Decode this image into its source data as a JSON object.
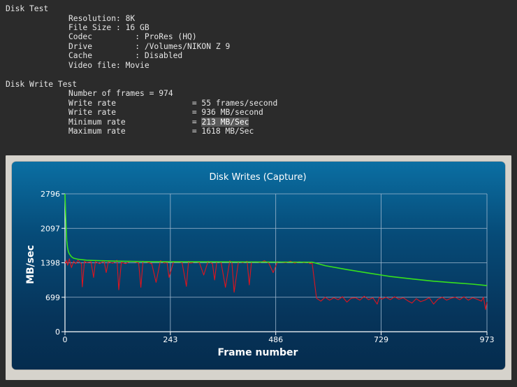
{
  "disk_test": {
    "title": "Disk Test",
    "resolution": "Resolution: 8K",
    "file_size": "File Size : 16 GB",
    "codec": "Codec         : ProRes (HQ)",
    "drive": "Drive         : /Volumes/NIKON Z 9",
    "cache": "Cache         : Disabled",
    "video_file": "Video file: Movie"
  },
  "write_test": {
    "title": "Disk Write Test",
    "frames": "Number of frames = 974",
    "write_rate_fps": "Write rate                = 55 frames/second",
    "write_rate_mbs": "Write rate                = 936 MB/second",
    "min_rate_label": "Minimum rate              = ",
    "min_rate_value": "213 MB/Sec",
    "max_rate": "Maximum rate              = 1618 MB/Sec"
  },
  "colors": {
    "per_frame_line": "#e0141e",
    "average_line": "#37e01c",
    "grid": "#9fb8cf",
    "axis_text": "#ffffff"
  },
  "chart_data": {
    "type": "line",
    "title": "Disk Writes (Capture)",
    "xlabel": "Frame number",
    "ylabel": "MB/sec",
    "xlim": [
      0,
      973
    ],
    "ylim": [
      0,
      2796
    ],
    "x_ticks": [
      0,
      243,
      486,
      729,
      973
    ],
    "y_ticks": [
      0,
      699,
      1398,
      2097,
      2796
    ],
    "grid": true,
    "legend": "none",
    "series": [
      {
        "color": "#37e01c",
        "x": [
          0,
          1,
          2,
          3,
          4,
          6,
          8,
          10,
          15,
          20,
          30,
          50,
          80,
          120,
          200,
          300,
          400,
          500,
          570,
          575,
          600,
          650,
          700,
          729,
          750,
          800,
          850,
          900,
          940,
          973
        ],
        "y": [
          2796,
          2550,
          2300,
          2050,
          1850,
          1700,
          1620,
          1580,
          1520,
          1490,
          1470,
          1450,
          1440,
          1430,
          1420,
          1418,
          1415,
          1412,
          1410,
          1400,
          1340,
          1260,
          1190,
          1150,
          1120,
          1070,
          1025,
          990,
          965,
          935
        ]
      },
      {
        "color": "#e0141e",
        "x": [
          0,
          2,
          4,
          6,
          8,
          10,
          15,
          20,
          25,
          30,
          35,
          38,
          40,
          45,
          50,
          60,
          66,
          70,
          80,
          90,
          95,
          100,
          110,
          120,
          124,
          130,
          140,
          150,
          160,
          170,
          175,
          180,
          190,
          200,
          210,
          220,
          230,
          235,
          240,
          250,
          260,
          270,
          280,
          285,
          290,
          300,
          310,
          320,
          330,
          340,
          345,
          350,
          360,
          370,
          380,
          385,
          390,
          400,
          410,
          420,
          425,
          430,
          440,
          450,
          460,
          470,
          480,
          490,
          500,
          510,
          520,
          530,
          540,
          550,
          560,
          565,
          570,
          580,
          590,
          600,
          610,
          620,
          630,
          640,
          650,
          660,
          670,
          680,
          690,
          700,
          710,
          720,
          725,
          730,
          740,
          750,
          760,
          770,
          780,
          790,
          800,
          810,
          820,
          830,
          840,
          850,
          860,
          870,
          880,
          890,
          900,
          910,
          920,
          930,
          940,
          950,
          960,
          965,
          970,
          973
        ],
        "y": [
          1420,
          1390,
          1450,
          1350,
          1400,
          1480,
          1300,
          1430,
          1380,
          1450,
          1400,
          1380,
          910,
          1430,
          1400,
          1420,
          1100,
          1420,
          1380,
          1440,
          1200,
          1420,
          1390,
          1450,
          850,
          1410,
          1380,
          1430,
          1420,
          1390,
          900,
          1430,
          1410,
          1380,
          1000,
          1440,
          1390,
          1420,
          1100,
          1410,
          1420,
          1400,
          920,
          1430,
          1390,
          1420,
          1400,
          1150,
          1430,
          1380,
          1050,
          1420,
          1400,
          900,
          1440,
          1390,
          800,
          1420,
          1400,
          1430,
          950,
          1410,
          1420,
          1400,
          1440,
          1390,
          1200,
          1420,
          1410,
          1400,
          1430,
          1390,
          1420,
          1400,
          1410,
          1380,
          1395,
          680,
          620,
          700,
          640,
          690,
          650,
          710,
          600,
          680,
          690,
          640,
          720,
          650,
          690,
          560,
          700,
          660,
          700,
          650,
          710,
          660,
          690,
          630,
          580,
          670,
          610,
          640,
          690,
          560,
          660,
          700,
          640,
          680,
          700,
          650,
          710,
          640,
          690,
          660,
          620,
          700,
          450,
          600
        ]
      }
    ]
  }
}
